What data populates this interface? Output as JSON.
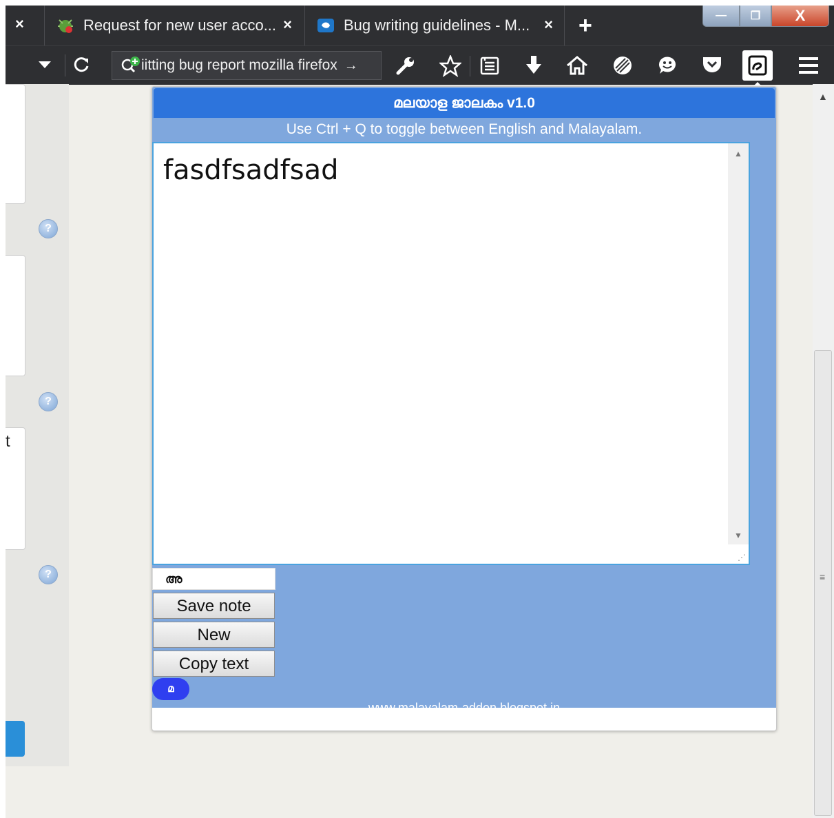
{
  "browser": {
    "tabs": [
      {
        "title": "Request for new user acco...",
        "close": "×"
      },
      {
        "title": "Bug writing guidelines - M...",
        "close": "×"
      }
    ],
    "close_left": "×",
    "new_tab": "+",
    "window_controls": {
      "minimize": "—",
      "maximize": "❐",
      "close": "X"
    },
    "url": "iitting bug report mozilla firefox",
    "url_arrow": "→"
  },
  "popup": {
    "title": "മലയാള ജാലകം v1.0",
    "hint": "Use Ctrl + Q to toggle between English and Malayalam.",
    "note_text": "fasdfsadfsad",
    "language_indicator": "അ",
    "buttons": {
      "save": "Save note",
      "new": "New",
      "copy": "Copy text"
    },
    "toggle_pill": "മ",
    "footer_link": "www.malayalam-addon.blogspot.in"
  },
  "page": {
    "left_edge_text": "t",
    "help_icon": "?"
  },
  "colors": {
    "browser_chrome": "#2e2f32",
    "popup_title_bg": "#2d74dc",
    "popup_panel_bg": "#7fa7dd",
    "pill_bg": "#2f3ff0"
  }
}
